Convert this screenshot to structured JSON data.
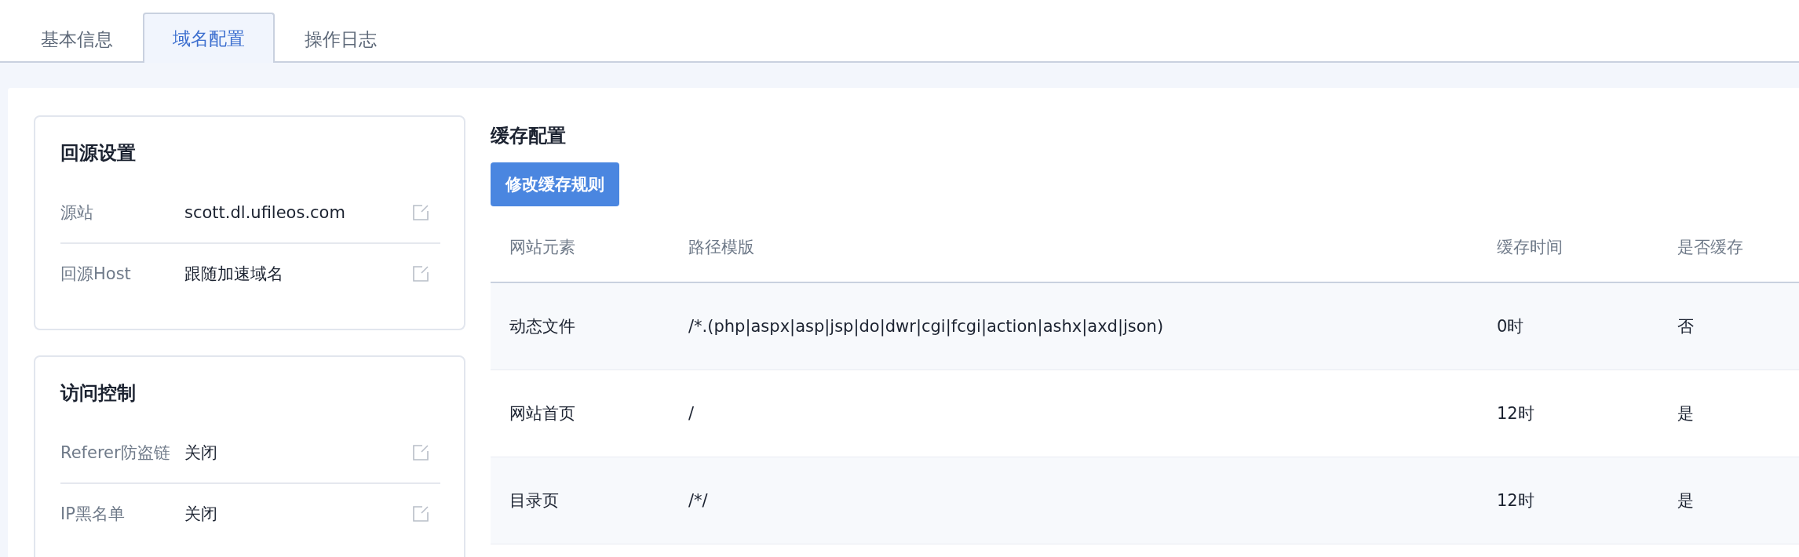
{
  "tabs": [
    {
      "label": "基本信息",
      "selected": false
    },
    {
      "label": "域名配置",
      "selected": true
    },
    {
      "label": "操作日志",
      "selected": false
    }
  ],
  "cards": [
    {
      "title": "回源设置",
      "rows": [
        {
          "label": "源站",
          "value": "scott.dl.ufileos.com"
        },
        {
          "label": "回源Host",
          "value": "跟随加速域名"
        }
      ]
    },
    {
      "title": "访问控制",
      "rows": [
        {
          "label": "Referer防盗链",
          "value": "关闭"
        },
        {
          "label": "IP黑名单",
          "value": "关闭"
        }
      ]
    }
  ],
  "cache": {
    "title": "缓存配置",
    "button": "修改缓存规则",
    "columns": [
      "网站元素",
      "路径模版",
      "缓存时间",
      "是否缓存"
    ],
    "rows": [
      [
        "动态文件",
        "/*.(php|aspx|asp|jsp|do|dwr|cgi|fcgi|action|ashx|axd|json)",
        "0时",
        "否"
      ],
      [
        "网站首页",
        "/",
        "12时",
        "是"
      ],
      [
        "目录页",
        "/*/",
        "12时",
        "是"
      ]
    ]
  }
}
